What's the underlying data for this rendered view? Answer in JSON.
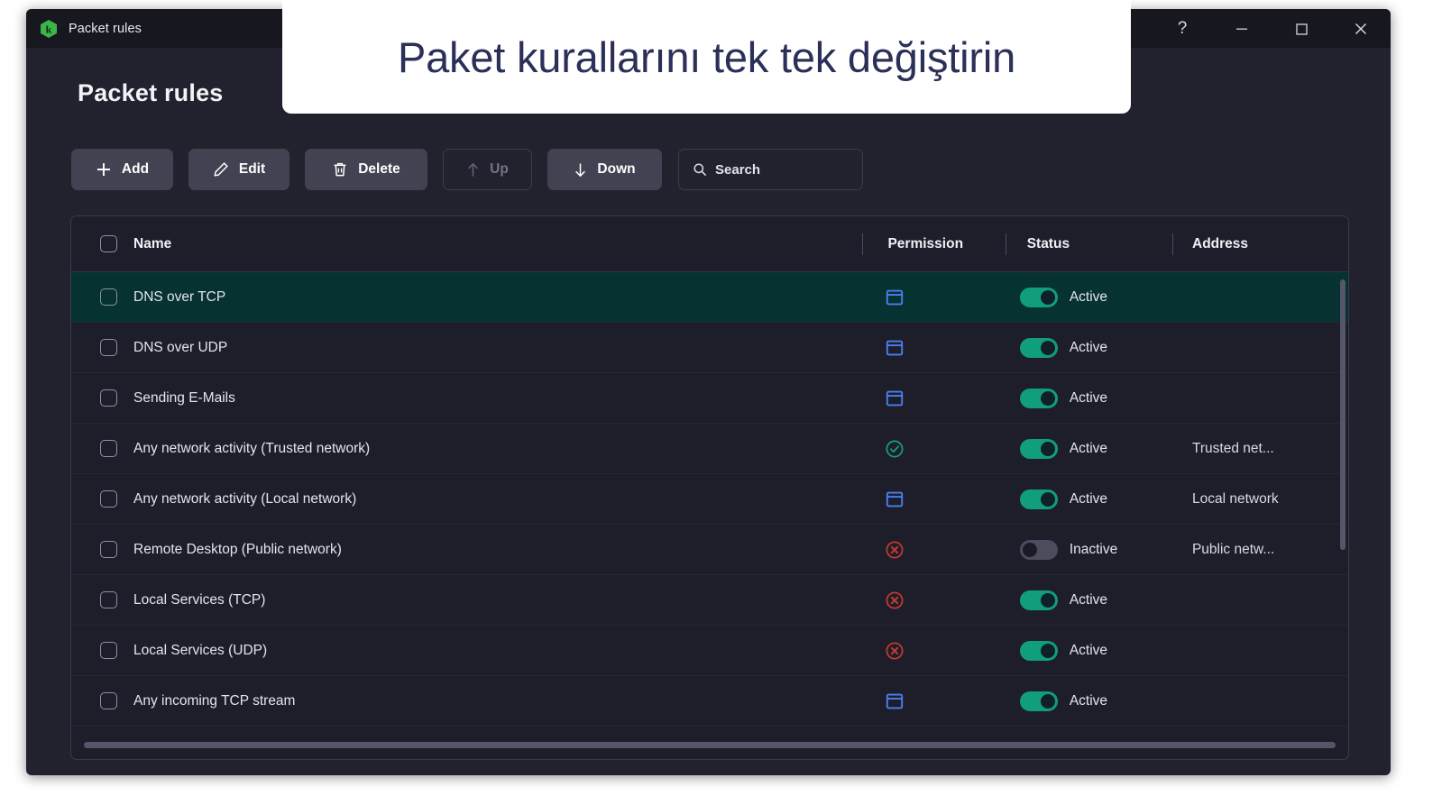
{
  "callout": {
    "text": "Paket kurallarını tek tek değiştirin"
  },
  "window": {
    "titlebar_title": "Packet rules",
    "logo_icon": "kaspersky-hex-logo",
    "controls": {
      "help": "?",
      "minimize": "minimize-icon",
      "maximize": "maximize-icon",
      "close": "close-icon"
    },
    "accent_green": "#3bb54a",
    "selected_row_color": "#063231",
    "toggle_on_color": "#119e7d"
  },
  "page": {
    "title": "Packet rules"
  },
  "toolbar": {
    "add_label": "Add",
    "edit_label": "Edit",
    "delete_label": "Delete",
    "up_label": "Up",
    "down_label": "Down",
    "up_disabled": true,
    "search_placeholder": "Search",
    "search_value": ""
  },
  "table": {
    "columns": {
      "name": "Name",
      "permission": "Permission",
      "status": "Status",
      "address": "Address"
    },
    "rows": [
      {
        "name": "DNS over TCP",
        "permission": "prompt",
        "status": "Active",
        "status_on": true,
        "address": "",
        "selected": true,
        "checked": false
      },
      {
        "name": "DNS over UDP",
        "permission": "prompt",
        "status": "Active",
        "status_on": true,
        "address": "",
        "selected": false,
        "checked": false
      },
      {
        "name": "Sending E-Mails",
        "permission": "prompt",
        "status": "Active",
        "status_on": true,
        "address": "",
        "selected": false,
        "checked": false
      },
      {
        "name": "Any network activity (Trusted network)",
        "permission": "allow",
        "status": "Active",
        "status_on": true,
        "address": "Trusted net...",
        "selected": false,
        "checked": false
      },
      {
        "name": "Any network activity (Local network)",
        "permission": "prompt",
        "status": "Active",
        "status_on": true,
        "address": "Local network",
        "selected": false,
        "checked": false
      },
      {
        "name": "Remote Desktop (Public network)",
        "permission": "block",
        "status": "Inactive",
        "status_on": false,
        "address": "Public netw...",
        "selected": false,
        "checked": false
      },
      {
        "name": "Local Services (TCP)",
        "permission": "block",
        "status": "Active",
        "status_on": true,
        "address": "",
        "selected": false,
        "checked": false
      },
      {
        "name": "Local Services (UDP)",
        "permission": "block",
        "status": "Active",
        "status_on": true,
        "address": "",
        "selected": false,
        "checked": false
      },
      {
        "name": "Any incoming TCP stream",
        "permission": "prompt",
        "status": "Active",
        "status_on": true,
        "address": "",
        "selected": false,
        "checked": false
      }
    ]
  }
}
